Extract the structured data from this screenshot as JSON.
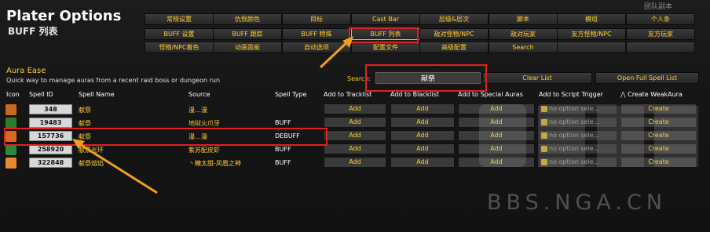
{
  "header": {
    "title": "Plater Options",
    "subtitle": "BUFF 列表",
    "corner_text": "团队副本"
  },
  "tabs": [
    [
      "常规设置",
      "仇恨颜色",
      "目标",
      "Cast Bar",
      "层级&层次",
      "脚本",
      "模组",
      "个人条"
    ],
    [
      "BUFF 设置",
      "BUFF 跟踪",
      "BUFF 特殊",
      "BUFF 列表",
      "敌对怪物/NPC",
      "敌对玩家",
      "友方怪物/NPC",
      "友方玩家"
    ],
    [
      "怪物/NPC着色",
      "动画面板",
      "自动选项",
      "配置文件",
      "高级配置",
      "Search",
      "",
      ""
    ]
  ],
  "selected_tab": "BUFF 列表",
  "section": {
    "title": "Aura Ease",
    "description": "Quick way to manage auras from a recent raid boss or dungeon run"
  },
  "search": {
    "label": "Search:",
    "value": "献祭"
  },
  "buttons": {
    "clear_list": "Clear List",
    "open_full_spell_list": "Open Full Spell List"
  },
  "columns": {
    "icon": "Icon",
    "spell_id": "Spell ID",
    "spell_name": "Spell Name",
    "source": "Source",
    "spell_type": "Spell Type",
    "add_tracklist": "Add to Tracklist",
    "add_blacklist": "Add to Blacklist",
    "add_special": "Add to Special Auras",
    "add_script_trigger": "Add to Script Trigger",
    "create_weakaura": "Create WeakAura"
  },
  "rows": [
    {
      "spell_id": "348",
      "spell_name": "献祭",
      "source": "漫…漫",
      "spell_type": "",
      "icon_color": "#c86a1a"
    },
    {
      "spell_id": "19483",
      "spell_name": "献祭",
      "source": "地狱火爪牙",
      "spell_type": "BUFF",
      "icon_color": "#2f7a2a"
    },
    {
      "spell_id": "157736",
      "spell_name": "献祭",
      "source": "漫…漫",
      "spell_type": "DEBUFF",
      "icon_color": "#d8691c"
    },
    {
      "spell_id": "258920",
      "spell_name": "献祭光环",
      "source": "紫苏配皮虾",
      "spell_type": "BUFF",
      "icon_color": "#2a8a3a"
    },
    {
      "spell_id": "322848",
      "spell_name": "献祭熔焰",
      "source": "丶糖太甜-凤凰之神",
      "spell_type": "BUFF",
      "icon_color": "#e88a2a"
    }
  ],
  "row_actions": {
    "add": "Add",
    "script_placeholder": "no option sele...",
    "create": "Create"
  },
  "watermark": "BBS.NGA.CN",
  "colors": {
    "accent": "#ffcc33",
    "highlight": "#e02020",
    "arrow": "#f0a020"
  }
}
